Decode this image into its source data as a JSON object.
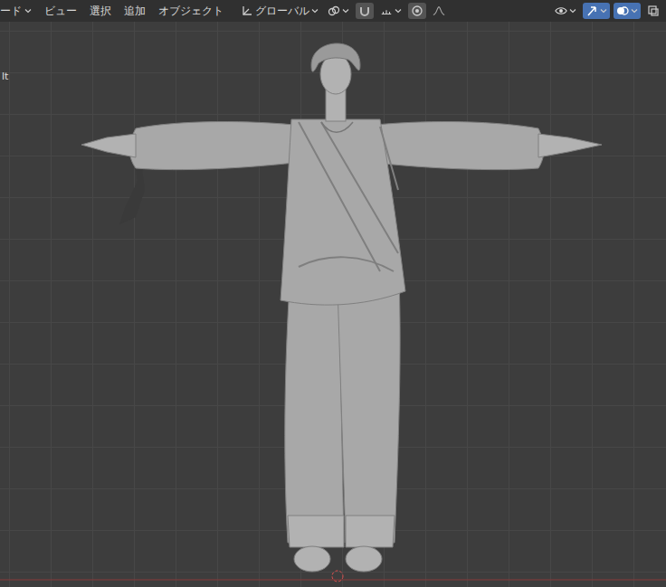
{
  "header": {
    "menus": [
      {
        "label": "ード",
        "kind": "dropdown"
      },
      {
        "label": "ビュー",
        "kind": "menu"
      },
      {
        "label": "選択",
        "kind": "menu"
      },
      {
        "label": "追加",
        "kind": "menu"
      },
      {
        "label": "オブジェクト",
        "kind": "menu"
      }
    ],
    "transform_orientation": "グローバル",
    "snapping": {
      "on": false
    },
    "proportional_editing": {
      "on": false
    },
    "viewport_toggles": [
      {
        "kind": "visibility",
        "on": false
      },
      {
        "kind": "gizmos",
        "on": true
      },
      {
        "kind": "overlays",
        "on": true
      },
      {
        "kind": "xray",
        "on": false
      }
    ]
  },
  "viewport": {
    "overlay_text": "lt"
  }
}
